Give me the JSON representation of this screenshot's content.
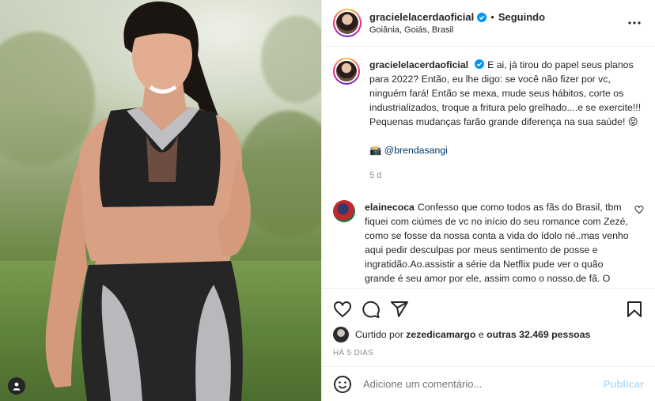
{
  "header": {
    "username": "gracielelacerdaoficial",
    "separator": "•",
    "follow_status": "Seguindo",
    "location": "Goiânia, Goiás, Brasil"
  },
  "caption": {
    "username": "gracielelacerdaoficial",
    "text": "E ai, já tirou do papel seus planos para 2022? Então, eu lhe digo: se você não fizer por vc, ninguém fará! Então se mexa, mude seus hábitos, corte os industrializados, troque a fritura pelo grelhado....e se exercite!!! Pequenas mudanças farão grande diferença na sua saúde! 😝",
    "camera_emoji": "📸",
    "mention": "@brendasangi",
    "time": "5 d"
  },
  "comment": {
    "username": "elainecoca",
    "text": "Confesso que como todos as fãs do Brasil, tbm fiquei com ciúmes de vc no início do seu romance com Zezé, como se fosse da nossa conta a vida do ídolo né..mas venho aqui pedir desculpas por meus sentimento de posse e ingratidão.Ao.assistir a série da Netflix pude ver o quão grande é seu amor por ele, assim como o nosso.de fã. O quanto vc faz bem a ele, a sua doçura e meiguice me conquistou...virei sua Fã tbm...torço por sua felicidade e sucesso, e que venha logo um bebêzinho...que Nossa Senhora"
  },
  "likes": {
    "prefix": "Curtido por",
    "user": "zezedicamargo",
    "middle": "e",
    "others": "outras 32.469 pessoas"
  },
  "posted_ago": "HÁ 5 DIAS",
  "add_comment": {
    "placeholder": "Adicione um comentário...",
    "publish_label": "Publicar"
  },
  "icons": [
    "verified-badge-icon",
    "more-options-icon",
    "heart-icon",
    "comment-icon",
    "share-icon",
    "save-icon",
    "emoji-icon",
    "user-tag-icon"
  ],
  "colors": {
    "verified": "#0095f6",
    "mention": "#00376b",
    "muted": "#8e8e8e",
    "publish": "#b2dffc"
  }
}
